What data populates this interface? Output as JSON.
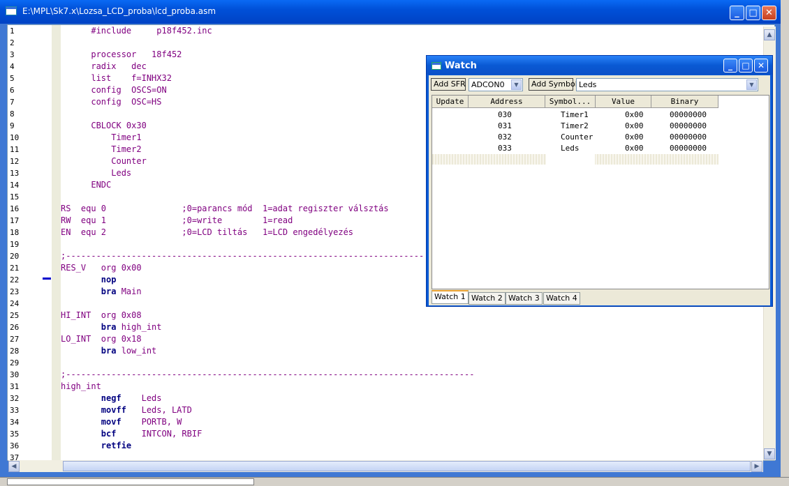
{
  "window": {
    "title": "E:\\MPL\\Sk7.x\\Lozsa_LCD_proba\\lcd_proba.asm",
    "buttons": {
      "minimize": "_",
      "maximize": "□",
      "close": "✕"
    }
  },
  "editor": {
    "line_numbers": [
      "1",
      "2",
      "3",
      "4",
      "5",
      "6",
      "7",
      "8",
      "9",
      "10",
      "11",
      "12",
      "13",
      "14",
      "15",
      "16",
      "17",
      "18",
      "19",
      "20",
      "21",
      "22",
      "23",
      "24",
      "25",
      "26",
      "27",
      "28",
      "29",
      "30",
      "31",
      "32",
      "33",
      "34",
      "35",
      "36",
      "37"
    ],
    "lines": [
      "      #include     p18f452.inc",
      "",
      "      processor   18f452",
      "      radix   dec",
      "      list    f=INHX32",
      "      config  OSCS=ON",
      "      config  OSC=HS",
      "",
      "      CBLOCK 0x30",
      "          Timer1",
      "          Timer2",
      "          Counter",
      "          Leds",
      "      ENDC",
      "",
      "RS  equ 0               ;0=parancs mód  1=adat regiszter válsztás",
      "RW  equ 1               ;0=write        1=read",
      "EN  equ 2               ;0=LCD tiltás   1=LCD engedélyezés",
      "",
      ";-----------------------------------------------------------------------",
      "RES_V   org 0x00",
      "        nop",
      "        bra Main",
      "",
      "HI_INT  org 0x08",
      "        bra high_int",
      "LO_INT  org 0x18",
      "        bra low_int",
      "",
      ";---------------------------------------------------------------------------------",
      "high_int",
      "        negf    Leds",
      "        movff   Leds, LATD",
      "        movf    PORTB, W",
      "        bcf     INTCON, RBIF",
      "        retfie",
      ""
    ]
  },
  "watch": {
    "title": "Watch",
    "add_sfr_label": "Add SFR",
    "sfr_value": "ADCON0",
    "add_symbol_label": "Add Symbol",
    "symbol_value": "Leds",
    "columns": [
      "Update",
      "Address",
      "Symbol...",
      "Value",
      "Binary"
    ],
    "rows": [
      {
        "update": "",
        "address": "030",
        "symbol": "Timer1",
        "value": "0x00",
        "binary": "00000000"
      },
      {
        "update": "",
        "address": "031",
        "symbol": "Timer2",
        "value": "0x00",
        "binary": "00000000"
      },
      {
        "update": "",
        "address": "032",
        "symbol": "Counter",
        "value": "0x00",
        "binary": "00000000"
      },
      {
        "update": "",
        "address": "033",
        "symbol": "Leds",
        "value": "0x00",
        "binary": "00000000"
      }
    ],
    "tabs": [
      "Watch 1",
      "Watch 2",
      "Watch 3",
      "Watch 4"
    ],
    "active_tab": "Watch 1"
  },
  "colors": {
    "titlebar": "#0050d8",
    "code_text": "#800080",
    "keyword_text": "#000080",
    "watch_bg": "#ece9d8"
  }
}
